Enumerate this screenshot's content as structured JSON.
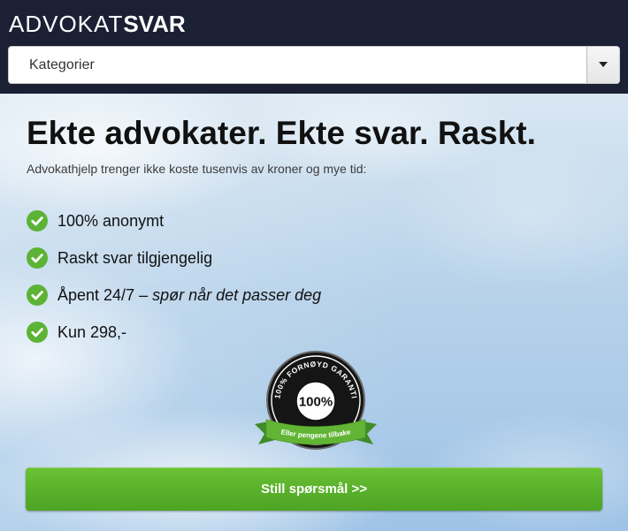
{
  "header": {
    "logo_light": "ADVOKAT",
    "logo_bold": "SVAR",
    "category_select": {
      "value": "Kategorier"
    }
  },
  "hero": {
    "title": "Ekte advokater. Ekte svar. Raskt.",
    "subtitle": "Advokathjelp trenger ikke koste tusenvis av kroner og mye tid:",
    "features": [
      {
        "text": "100% anonymt",
        "emphasis": ""
      },
      {
        "text": "Raskt svar tilgjengelig",
        "emphasis": ""
      },
      {
        "text": "Åpent 24/7",
        "emphasis": " – spør når det passer deg"
      },
      {
        "text": "Kun 298,-",
        "emphasis": ""
      }
    ]
  },
  "badge": {
    "arc_text": "100% FORNØYD GARANTI",
    "center_text": "100%",
    "ribbon_text": "Eller pengene tilbake"
  },
  "cta": {
    "label": "Still spørsmål >>"
  },
  "icons": {
    "feature_icon": "check-circle-icon",
    "select_arrow": "chevron-down-icon"
  },
  "colors": {
    "header_bg": "#1c2034",
    "check_green": "#5cb335",
    "ribbon_green": "#62b534",
    "button_green": "#58b02a",
    "text_dark": "#111111"
  }
}
